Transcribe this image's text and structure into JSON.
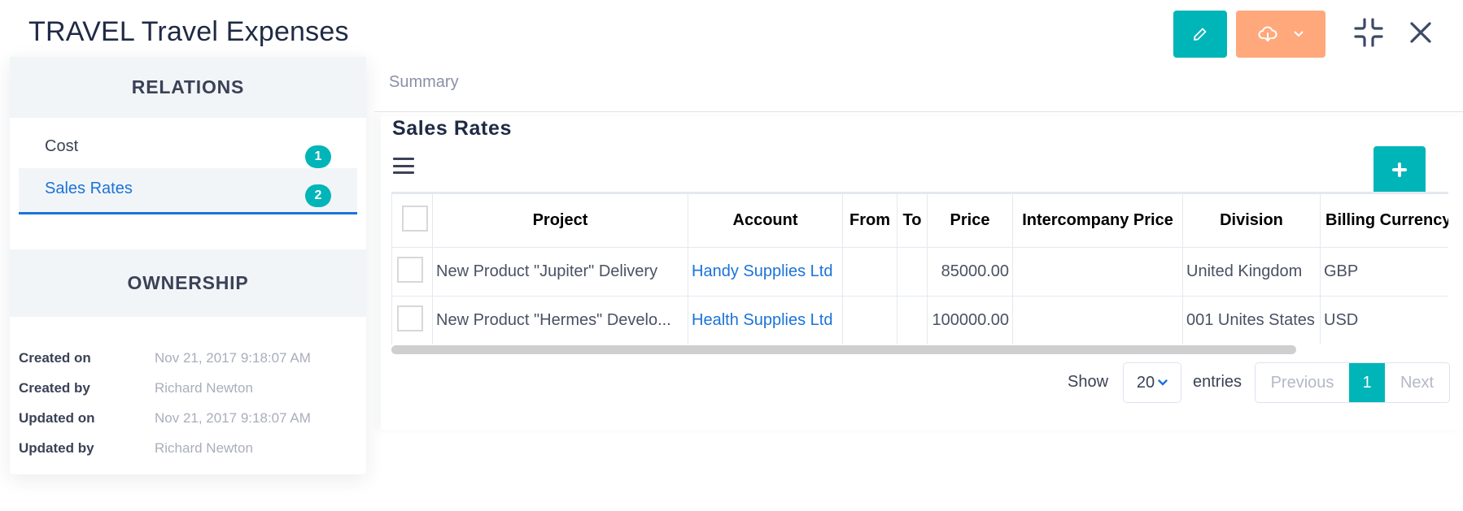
{
  "header": {
    "title": "TRAVEL Travel Expenses",
    "edit_icon": "pencil-icon",
    "download_icon": "cloud-download-icon",
    "compress_icon": "compress-icon",
    "close_icon": "close-icon"
  },
  "sidebar": {
    "relations_title": "RELATIONS",
    "relations": [
      {
        "label": "Cost",
        "count": "1",
        "active": false
      },
      {
        "label": "Sales Rates",
        "count": "2",
        "active": true
      }
    ],
    "ownership_title": "OWNERSHIP",
    "ownership": [
      {
        "label": "Created on",
        "value": "Nov 21, 2017 9:18:07 AM"
      },
      {
        "label": "Created by",
        "value": "Richard Newton"
      },
      {
        "label": "Updated on",
        "value": "Nov 21, 2017 9:18:07 AM"
      },
      {
        "label": "Updated by",
        "value": "Richard Newton"
      }
    ]
  },
  "tabs": {
    "summary": "Summary"
  },
  "section": {
    "title": "Sales Rates",
    "add_icon": "plus-icon",
    "menu_icon": "hamburger-icon"
  },
  "table": {
    "columns": [
      "Project",
      "Account",
      "From",
      "To",
      "Price",
      "Intercompany Price",
      "Division",
      "Billing Currency"
    ],
    "rows": [
      {
        "project": "New Product \"Jupiter\" Delivery",
        "account": "Handy Supplies Ltd",
        "from": "",
        "to": "",
        "price": "85000.00",
        "intercompany_price": "",
        "division": "United Kingdom",
        "billing_currency": "GBP"
      },
      {
        "project": "New Product \"Hermes\" Develo...",
        "account": "Health Supplies Ltd",
        "from": "",
        "to": "",
        "price": "100000.00",
        "intercompany_price": "",
        "division": "001 Unites States",
        "billing_currency": "USD"
      }
    ]
  },
  "pagination": {
    "show_label": "Show",
    "page_size": "20",
    "entries_label": "entries",
    "previous": "Previous",
    "current_page": "1",
    "next": "Next"
  },
  "colors": {
    "accent": "#00b5b8",
    "download": "#ffa87c",
    "link": "#1a73d9"
  }
}
